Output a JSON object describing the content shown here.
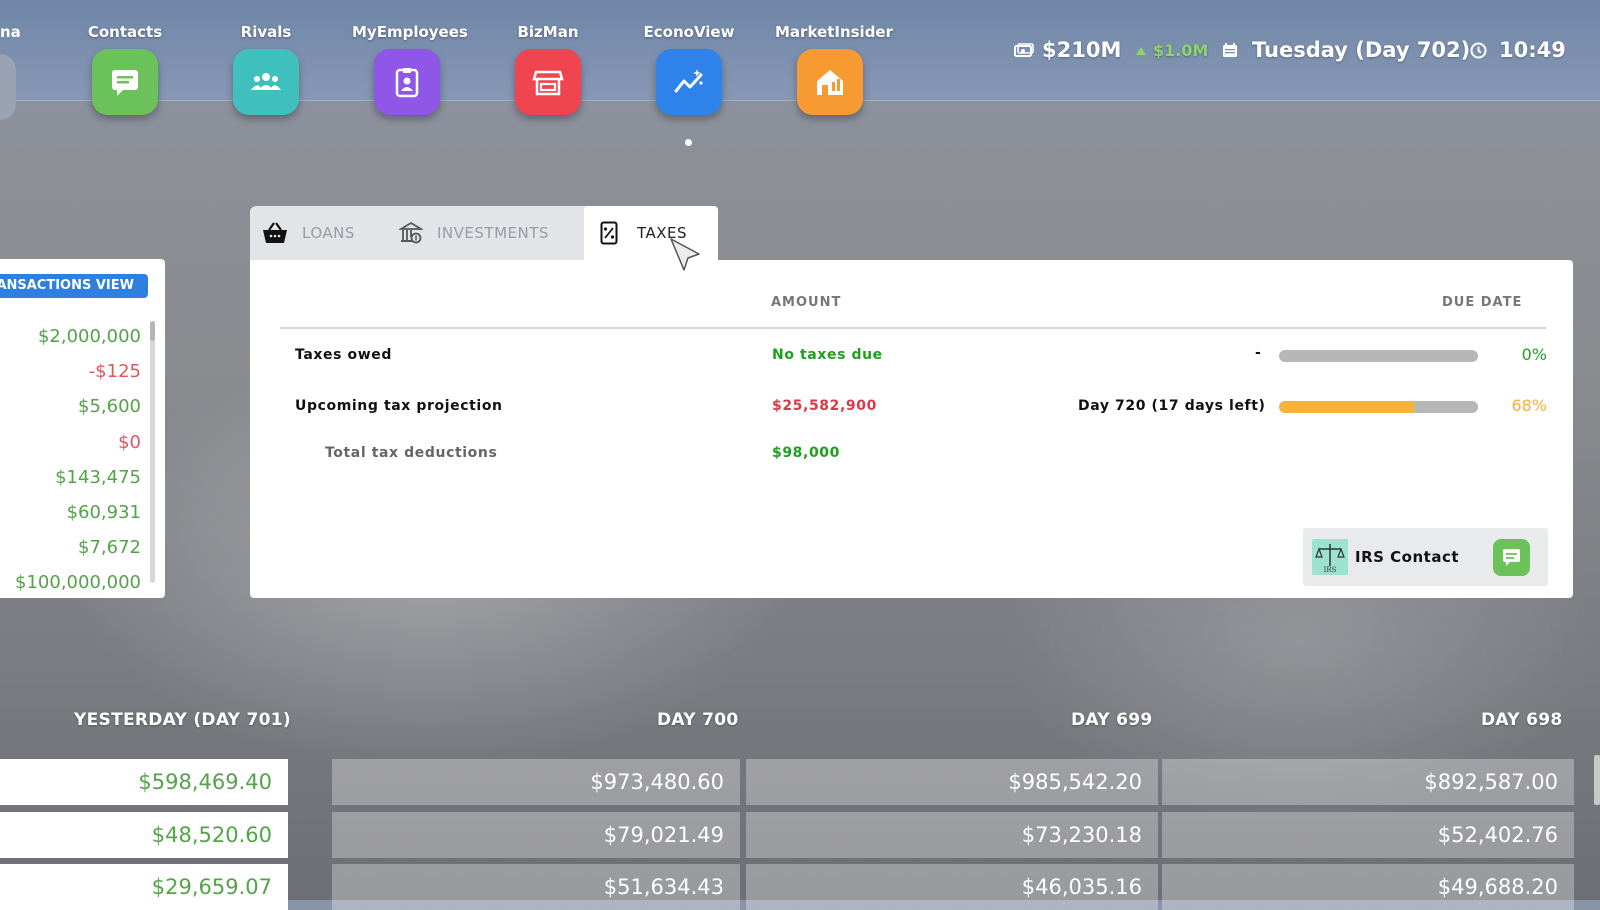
{
  "dock": {
    "left_partial": "na",
    "apps": [
      {
        "label": "Contacts",
        "icon": "chat-icon",
        "color": "#6cc25a"
      },
      {
        "label": "Rivals",
        "icon": "people-icon",
        "color": "#3fc0bd"
      },
      {
        "label": "MyEmployees",
        "icon": "badge-icon",
        "color": "#8e57e8"
      },
      {
        "label": "BizMan",
        "icon": "store-icon",
        "color": "#f0454f"
      },
      {
        "label": "EconoView",
        "icon": "chart-icon",
        "color": "#2f82ea"
      },
      {
        "label": "MarketInsider",
        "icon": "house-icon",
        "color": "#f79a32"
      }
    ]
  },
  "status": {
    "money": "$210M",
    "money_delta": "$1.0M",
    "date": "Tuesday (Day 702)",
    "time": "10:49"
  },
  "transactions": {
    "view_button": "ANSACTIONS VIEW",
    "items": [
      "$2,000,000",
      "-$125",
      "$5,600",
      "$0",
      "$143,475",
      "$60,931",
      "$7,672",
      "$100,000,000"
    ],
    "colors": [
      "#54a34a",
      "#e0565f",
      "#54a34a",
      "#e0565f",
      "#54a34a",
      "#54a34a",
      "#54a34a",
      "#54a34a"
    ]
  },
  "tabs": [
    {
      "label": "LOANS",
      "icon": "basket-icon"
    },
    {
      "label": "INVESTMENTS",
      "icon": "bank-icon"
    },
    {
      "label": "TAXES",
      "icon": "tax-doc-icon"
    }
  ],
  "taxes": {
    "col_amount": "AMOUNT",
    "col_due": "DUE DATE",
    "owed_label": "Taxes owed",
    "owed_value": "No taxes due",
    "owed_due": "-",
    "owed_pct": "0%",
    "owed_progress": 0,
    "proj_label": "Upcoming tax projection",
    "proj_value": "$25,582,900",
    "proj_due": "Day 720 (17 days left)",
    "proj_pct": "68%",
    "proj_progress": 0.68,
    "deduct_label": "Total tax deductions",
    "deduct_value": "$98,000",
    "irs_label": "IRS Contact",
    "irs_icon_text": "IRS",
    "green": "#1ea01e",
    "red": "#d93a47",
    "orange": "#f7b23b"
  },
  "history": {
    "headers": [
      "YESTERDAY (DAY 701)",
      "DAY 700",
      "DAY 699",
      "DAY 698"
    ],
    "rows": [
      [
        "$598,469.40",
        "$973,480.60",
        "$985,542.20",
        "$892,587.00"
      ],
      [
        "$48,520.60",
        "$79,021.49",
        "$73,230.18",
        "$52,402.76"
      ],
      [
        "$29,659.07",
        "$51,634.43",
        "$46,035.16",
        "$49,688.20"
      ]
    ]
  }
}
